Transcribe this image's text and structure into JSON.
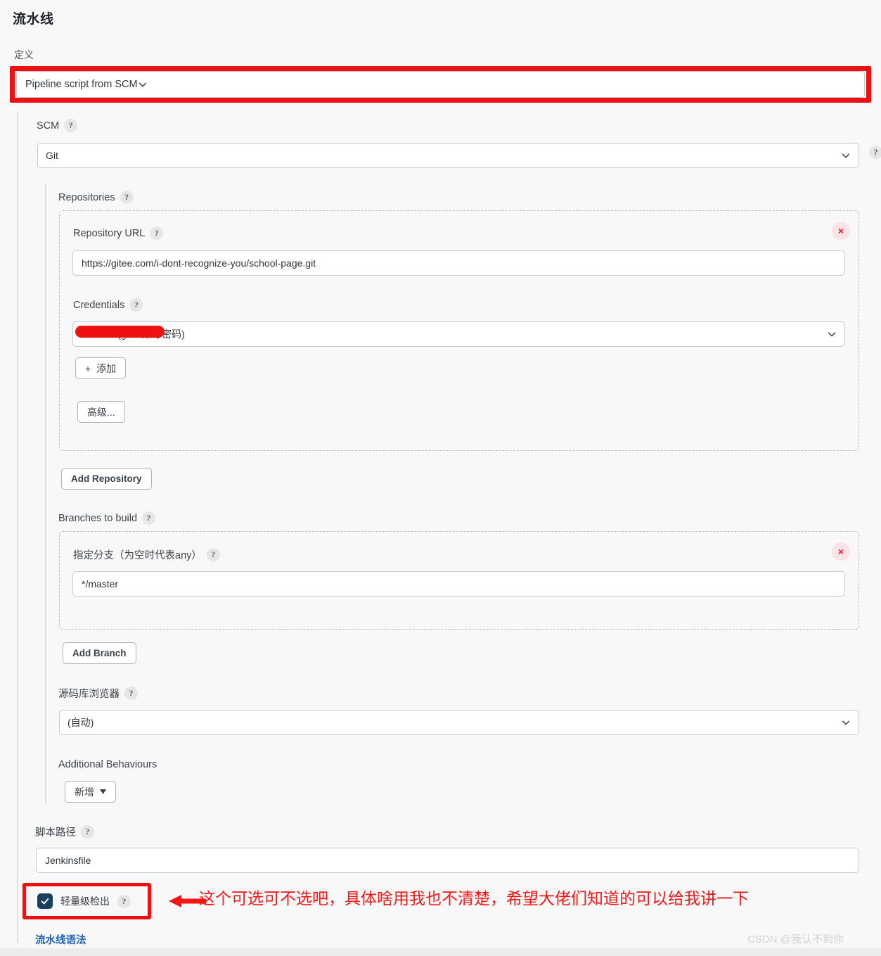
{
  "page": {
    "title": "流水线",
    "watermark": "CSDN @我认不到你"
  },
  "definition": {
    "label": "定义",
    "selected": "Pipeline script from SCM",
    "icon": "chevron-down-icon"
  },
  "scm": {
    "label": "SCM",
    "help": "?",
    "selected": "Git"
  },
  "repositories": {
    "label": "Repositories",
    "help": "?",
    "delete_icon": "×",
    "repository_url": {
      "label": "Repository URL",
      "help": "?",
      "value": "https://gitee.com/i-dont-recognize-you/school-page.git"
    },
    "credentials": {
      "label": "Credentials",
      "help": "?",
      "value": "m/****** (gitee账号密码)",
      "add_button": "添加",
      "add_icon": "plus-icon",
      "advanced_button": "高级..."
    },
    "add_repository_button": "Add Repository"
  },
  "branches": {
    "label": "Branches to build",
    "help": "?",
    "delete_icon": "×",
    "spec_label": "指定分支（为空时代表any）",
    "spec_help": "?",
    "spec_value": "*/master",
    "add_branch_button": "Add Branch"
  },
  "repository_browser": {
    "label": "源码库浏览器",
    "help": "?",
    "selected": "(自动)"
  },
  "additional_behaviours": {
    "label": "Additional Behaviours",
    "add_button": "新增",
    "caret_icon": "caret-down-icon"
  },
  "script_path": {
    "label": "脚本路径",
    "help": "?",
    "value": "Jenkinsfile"
  },
  "lightweight_checkout": {
    "label": "轻量级检出",
    "help": "?",
    "checked": true,
    "check_icon": "check-icon"
  },
  "pipeline_syntax_link": "流水线语法",
  "annotation": {
    "text": "这个可选可不选吧，具体啥用我也不清楚，希望大佬们知道的可以给我讲一下",
    "arrow_icon": "left-arrow-icon",
    "color": "#fa1414"
  },
  "colors": {
    "highlight_red": "#ee1111",
    "checkbox_navy": "#17405e",
    "link_blue": "#1c62b5",
    "background": "#f8f8f9"
  }
}
